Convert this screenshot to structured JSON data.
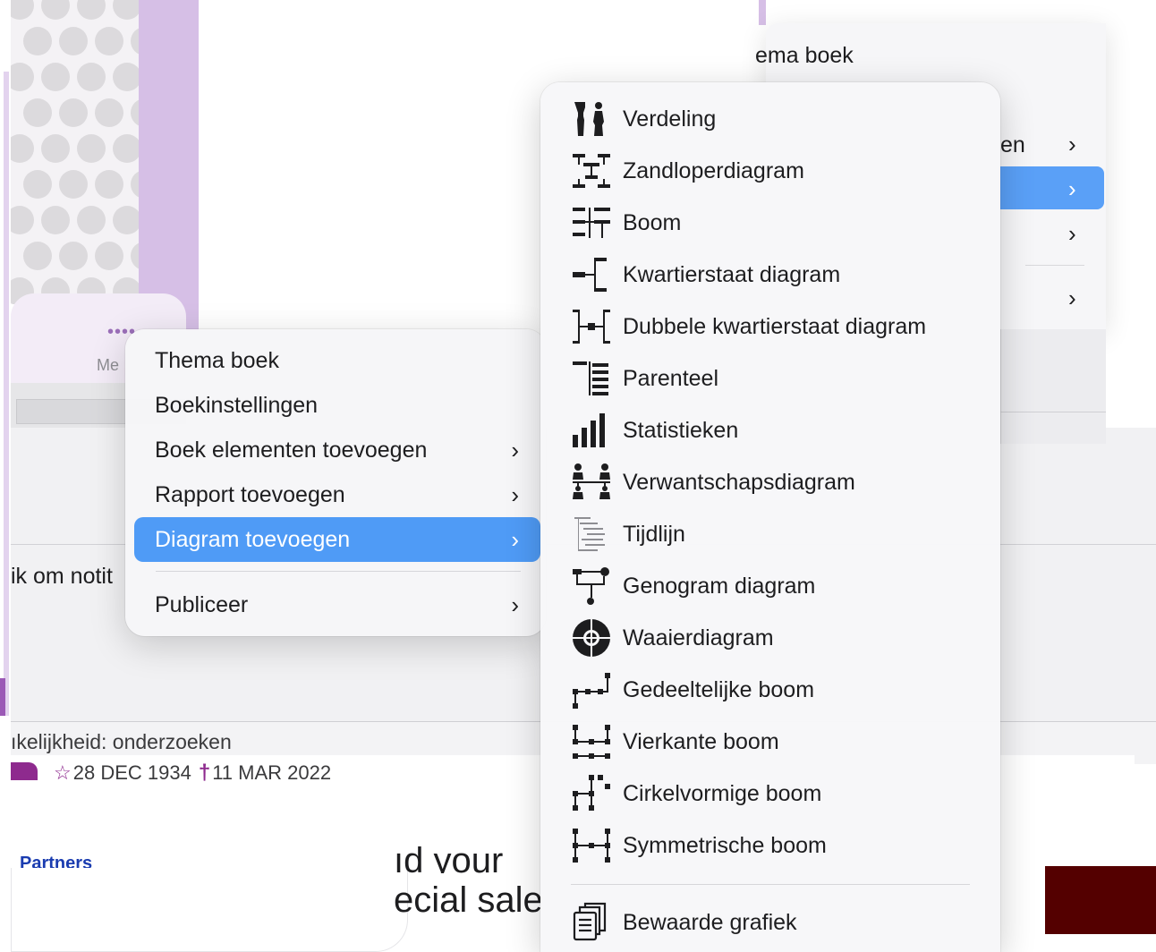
{
  "background": {
    "card_more_dots": "••••",
    "card_more_label": "Me",
    "notes_hint": "ik om notit",
    "status_text": "ıkelijkheid: onderzoeken",
    "birth_date": "28 DEC 1934",
    "death_date": "11 MAR 2022",
    "partners_label": "Partners",
    "promo_line1": "ıd your",
    "promo_line2": "ecial sale",
    "bg_menu_title": "ema boek",
    "bg_menu_item_en": "en"
  },
  "context_menu": {
    "items": [
      {
        "label": "Thema boek",
        "submenu": false,
        "selected": false
      },
      {
        "label": "Boekinstellingen",
        "submenu": false,
        "selected": false
      },
      {
        "label": "Boek elementen toevoegen",
        "submenu": true,
        "selected": false
      },
      {
        "label": "Rapport toevoegen",
        "submenu": true,
        "selected": false
      },
      {
        "label": "Diagram toevoegen",
        "submenu": true,
        "selected": true
      },
      {
        "label": "Publiceer",
        "submenu": true,
        "selected": false
      }
    ],
    "chevron": "›"
  },
  "diagram_submenu": {
    "items": [
      {
        "label": "Verdeling",
        "icon": "distribution-icon"
      },
      {
        "label": "Zandloperdiagram",
        "icon": "hourglass-chart-icon"
      },
      {
        "label": "Boom",
        "icon": "tree-icon"
      },
      {
        "label": "Kwartierstaat diagram",
        "icon": "ancestor-chart-icon"
      },
      {
        "label": "Dubbele kwartierstaat diagram",
        "icon": "double-ancestor-chart-icon"
      },
      {
        "label": "Parenteel",
        "icon": "descendant-list-icon"
      },
      {
        "label": "Statistieken",
        "icon": "statistics-icon"
      },
      {
        "label": "Verwantschapsdiagram",
        "icon": "relationship-chart-icon"
      },
      {
        "label": "Tijdlijn",
        "icon": "timeline-icon"
      },
      {
        "label": "Genogram diagram",
        "icon": "genogram-icon"
      },
      {
        "label": "Waaierdiagram",
        "icon": "fan-chart-icon"
      },
      {
        "label": "Gedeeltelijke boom",
        "icon": "partial-tree-icon"
      },
      {
        "label": "Vierkante boom",
        "icon": "square-tree-icon"
      },
      {
        "label": "Cirkelvormige boom",
        "icon": "circular-tree-icon"
      },
      {
        "label": "Symmetrische boom",
        "icon": "symmetric-tree-icon"
      },
      {
        "label": "Bewaarde grafiek",
        "icon": "saved-chart-icon"
      }
    ]
  },
  "colors": {
    "selection_blue": "#4f9bf6",
    "accent_purple": "#8e2a8e",
    "menu_bg": "#f6f6f8"
  }
}
